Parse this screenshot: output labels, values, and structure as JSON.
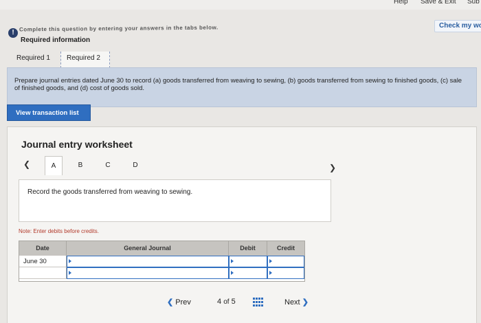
{
  "top": {
    "help_label": "Help",
    "save_exit_label": "Save & Exit",
    "submit_label": "Sub",
    "check_work_label": "Check my wor"
  },
  "instruction_text": "Complete this question by entering your answers in the tabs below.",
  "required_info_label": "Required information",
  "req_tabs": [
    {
      "label": "Required 1"
    },
    {
      "label": "Required 2"
    }
  ],
  "prompt": "Prepare journal entries dated June 30 to record (a) goods transferred from weaving to sewing, (b) goods transferred from sewing to finished goods, (c) sale of finished goods, and (d) cost of goods sold.",
  "view_transaction_label": "View transaction list",
  "worksheet": {
    "title": "Journal entry worksheet",
    "tabs": [
      "A",
      "B",
      "C",
      "D"
    ],
    "record_text": "Record the goods transferred from weaving to sewing.",
    "note": "Note: Enter debits before credits.",
    "columns": [
      "Date",
      "General Journal",
      "Debit",
      "Credit"
    ],
    "rows": [
      {
        "date": "June 30",
        "account": "",
        "debit": "",
        "credit": ""
      }
    ]
  },
  "pager": {
    "prev_label": "Prev",
    "current": "4",
    "of_label": "of",
    "total": "5",
    "next_label": "Next"
  }
}
